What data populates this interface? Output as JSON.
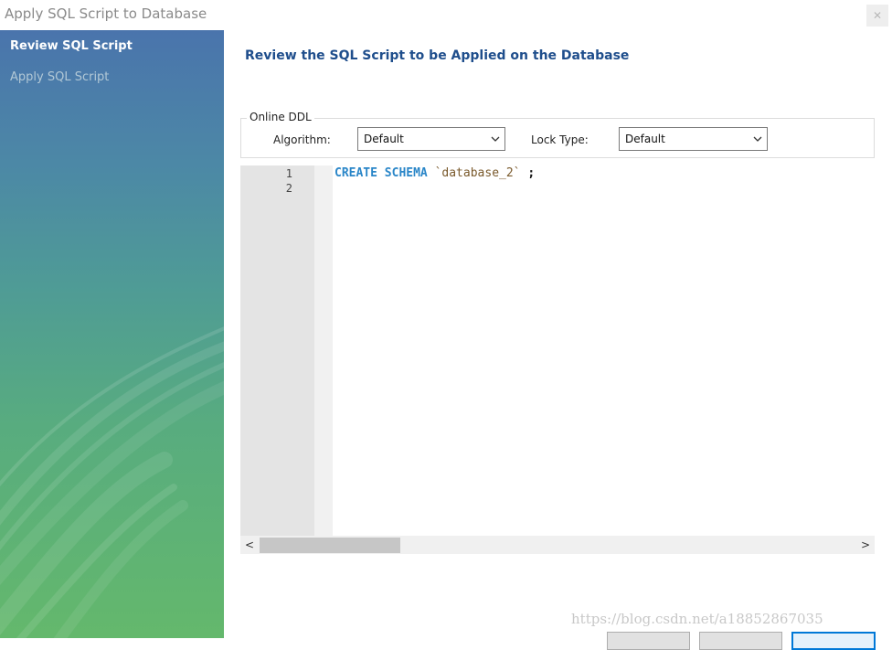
{
  "window": {
    "title": "Apply SQL Script to Database",
    "close_glyph": "✕",
    "close_icon": "close-icon"
  },
  "sidebar": {
    "items": [
      {
        "label": "Review SQL Script",
        "state": "active"
      },
      {
        "label": "Apply SQL Script",
        "state": "inactive"
      }
    ],
    "gradient_colors": [
      "#4a74ac",
      "#4f9b96",
      "#64b86c"
    ]
  },
  "main": {
    "title": "Review the SQL Script to be Applied on the Database",
    "title_color": "#1f4e8c"
  },
  "online_ddl": {
    "legend": "Online DDL",
    "algorithm_label": "Algorithm:",
    "algorithm_value": "Default",
    "lock_type_label": "Lock Type:",
    "lock_type_value": "Default",
    "dropdown_icon": "chevron-down-icon"
  },
  "editor": {
    "line_numbers": [
      "1",
      "2"
    ],
    "line1": {
      "keyword": "CREATE SCHEMA",
      "identifier": "`database_2`",
      "terminator": ";"
    },
    "keyword_color": "#2a86c8",
    "identifier_color": "#7a5a2c"
  },
  "scrollbar": {
    "left_arrow": "<",
    "right_arrow": ">",
    "position_fraction": 0.0
  },
  "watermark": "https://blog.csdn.net/a18852867035"
}
